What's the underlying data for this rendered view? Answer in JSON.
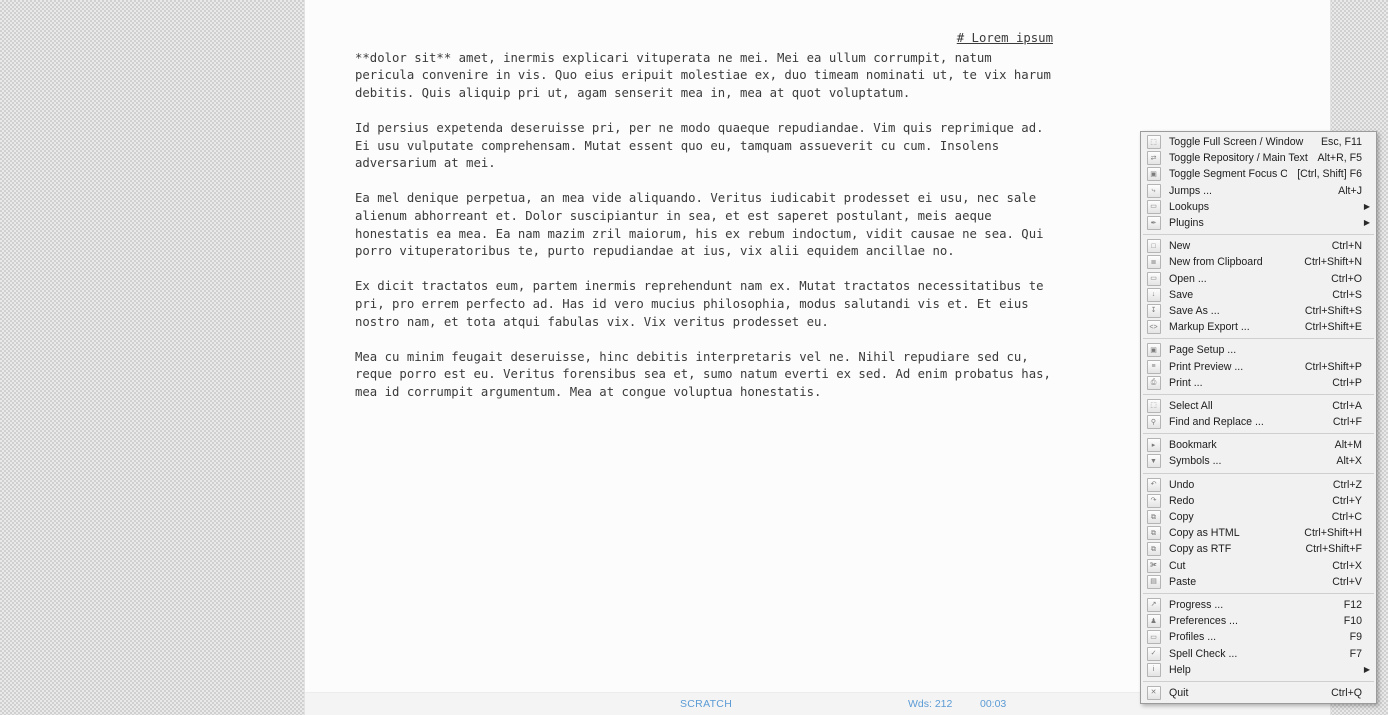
{
  "document": {
    "title": "# Lorem ipsum",
    "paragraphs": [
      "**dolor sit** amet, inermis explicari vituperata ne mei. Mei ea ullum corrumpit, natum\npericula convenire in vis. Quo eius eripuit molestiae ex, duo timeam nominati ut, te vix harum\ndebitis. Quis aliquip pri ut, agam senserit mea in, mea at quot voluptatum.",
      "Id persius expetenda deseruisse pri, per ne modo quaeque repudiandae. Vim quis reprimique ad.\nEi usu vulputate comprehensam. Mutat essent quo eu, tamquam assueverit cu cum. Insolens\nadversarium at mei.",
      "Ea mel denique perpetua, an mea vide aliquando. Veritus iudicabit prodesset ei usu, nec sale\nalienum abhorreant et. Dolor suscipiantur in sea, et est saperet postulant, meis aeque\nhonestatis ea mea. Ea nam mazim zril maiorum, his ex rebum indoctum, vidit causae ne sea. Qui\nporro vituperatoribus te, purto repudiandae at ius, vix alii equidem ancillae no.",
      "Ex dicit tractatos eum, partem inermis reprehendunt nam ex. Mutat tractatos necessitatibus te\npri, pro errem perfecto ad. Has id vero mucius philosophia, modus salutandi vis et. Et eius\nnostro nam, et tota atqui fabulas vix. Vix veritus prodesset eu.",
      "Mea cu minim feugait deseruisse, hinc debitis interpretaris vel ne. Nihil repudiare sed cu,\nreque porro est eu. Veritus forensibus sea et, sumo natum everti ex sed. Ad enim probatus has,\nmea id corrumpit argumentum. Mea at congue voluptua honestatis."
    ]
  },
  "status_bar": {
    "document_name": "SCRATCH",
    "word_count": "Wds: 212",
    "timer": "00:03",
    "accent_color": "#5b9bd5"
  },
  "context_menu": {
    "groups": [
      {
        "items": [
          {
            "icon": "fullscreen-icon",
            "glyph": "⬚",
            "label": "Toggle Full Screen / Window",
            "accel": "Esc, F11",
            "submenu": false
          },
          {
            "icon": "swap-arrows-icon",
            "glyph": "⇄",
            "label": "Toggle Repository / Main Text",
            "accel": "Alt+R, F5",
            "submenu": false
          },
          {
            "icon": "segment-focus-icon",
            "glyph": "▣",
            "label": "Toggle Segment Focus On / Off",
            "accel": "[Ctrl, Shift] F6",
            "submenu": false
          },
          {
            "icon": "jump-icon",
            "glyph": "⤷",
            "label": "Jumps ...",
            "accel": "Alt+J",
            "submenu": false
          },
          {
            "icon": "lookup-icon",
            "glyph": "▭",
            "label": "Lookups",
            "accel": "",
            "submenu": true
          },
          {
            "icon": "plugin-icon",
            "glyph": "✒",
            "label": "Plugins",
            "accel": "",
            "submenu": true
          }
        ]
      },
      {
        "items": [
          {
            "icon": "new-file-icon",
            "glyph": "□",
            "label": "New",
            "accel": "Ctrl+N",
            "submenu": false
          },
          {
            "icon": "clipboard-new-icon",
            "glyph": "≣",
            "label": "New from Clipboard",
            "accel": "Ctrl+Shift+N",
            "submenu": false
          },
          {
            "icon": "open-folder-icon",
            "glyph": "▭",
            "label": "Open ...",
            "accel": "Ctrl+O",
            "submenu": false
          },
          {
            "icon": "save-icon",
            "glyph": "↓",
            "label": "Save",
            "accel": "Ctrl+S",
            "submenu": false
          },
          {
            "icon": "save-as-icon",
            "glyph": "↧",
            "label": "Save As ...",
            "accel": "Ctrl+Shift+S",
            "submenu": false
          },
          {
            "icon": "markup-export-icon",
            "glyph": "<>",
            "label": "Markup Export ...",
            "accel": "Ctrl+Shift+E",
            "submenu": false
          }
        ]
      },
      {
        "items": [
          {
            "icon": "page-setup-icon",
            "glyph": "▣",
            "label": "Page Setup ...",
            "accel": "",
            "submenu": false
          },
          {
            "icon": "print-preview-icon",
            "glyph": "≡",
            "label": "Print Preview ...",
            "accel": "Ctrl+Shift+P",
            "submenu": false
          },
          {
            "icon": "printer-icon",
            "glyph": "⎙",
            "label": "Print ...",
            "accel": "Ctrl+P",
            "submenu": false
          }
        ]
      },
      {
        "items": [
          {
            "icon": "select-all-icon",
            "glyph": "⬚",
            "label": "Select All",
            "accel": "Ctrl+A",
            "submenu": false
          },
          {
            "icon": "find-replace-icon",
            "glyph": "⚲",
            "label": "Find and Replace ...",
            "accel": "Ctrl+F",
            "submenu": false
          }
        ]
      },
      {
        "items": [
          {
            "icon": "bookmark-icon",
            "glyph": "▸",
            "label": "Bookmark",
            "accel": "Alt+M",
            "submenu": false
          },
          {
            "icon": "symbols-icon",
            "glyph": "▼",
            "label": "Symbols ...",
            "accel": "Alt+X",
            "submenu": false
          }
        ]
      },
      {
        "items": [
          {
            "icon": "undo-icon",
            "glyph": "↶",
            "label": "Undo",
            "accel": "Ctrl+Z",
            "submenu": false
          },
          {
            "icon": "redo-icon",
            "glyph": "↷",
            "label": "Redo",
            "accel": "Ctrl+Y",
            "submenu": false
          },
          {
            "icon": "copy-icon",
            "glyph": "⧉",
            "label": "Copy",
            "accel": "Ctrl+C",
            "submenu": false
          },
          {
            "icon": "copy-html-icon",
            "glyph": "⧉",
            "label": "Copy as HTML",
            "accel": "Ctrl+Shift+H",
            "submenu": false
          },
          {
            "icon": "copy-rtf-icon",
            "glyph": "⧉",
            "label": "Copy as RTF",
            "accel": "Ctrl+Shift+F",
            "submenu": false
          },
          {
            "icon": "cut-icon",
            "glyph": "✀",
            "label": "Cut",
            "accel": "Ctrl+X",
            "submenu": false
          },
          {
            "icon": "paste-icon",
            "glyph": "▤",
            "label": "Paste",
            "accel": "Ctrl+V",
            "submenu": false
          }
        ]
      },
      {
        "items": [
          {
            "icon": "progress-icon",
            "glyph": "↗",
            "label": "Progress ...",
            "accel": "F12",
            "submenu": false
          },
          {
            "icon": "preferences-icon",
            "glyph": "♟",
            "label": "Preferences ...",
            "accel": "F10",
            "submenu": false
          },
          {
            "icon": "profiles-icon",
            "glyph": "▭",
            "label": "Profiles ...",
            "accel": "F9",
            "submenu": false
          },
          {
            "icon": "spell-check-icon",
            "glyph": "✓",
            "label": "Spell Check ...",
            "accel": "F7",
            "submenu": false
          },
          {
            "icon": "help-icon",
            "glyph": "i",
            "label": "Help",
            "accel": "",
            "submenu": true
          }
        ]
      },
      {
        "items": [
          {
            "icon": "quit-icon",
            "glyph": "✕",
            "label": "Quit",
            "accel": "Ctrl+Q",
            "submenu": false
          }
        ]
      }
    ]
  }
}
